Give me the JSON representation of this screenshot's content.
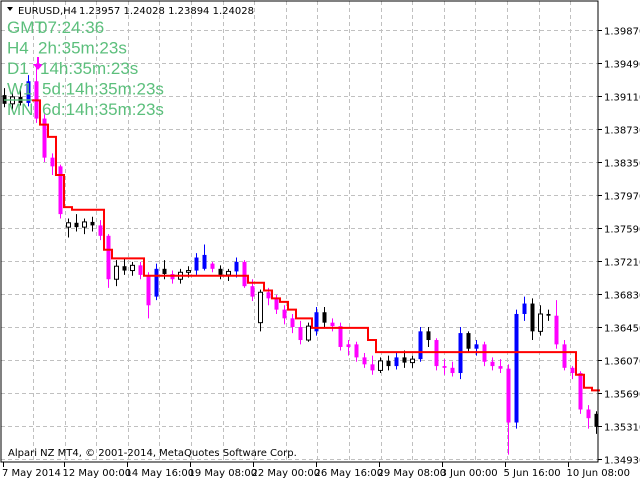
{
  "header": {
    "symbol": "EURUSD,H4",
    "ohlc": "1.23957 1.24028 1.23894 1.24028",
    "menu_icon": "triangle-down-icon"
  },
  "overlay": {
    "color": "#5cbf7c",
    "lines": [
      {
        "label": "GMT",
        "value": "07:24:36"
      },
      {
        "label": "H4",
        "value": "2h:35m:23s"
      },
      {
        "label": "D1",
        "value": "14h:35m:23s"
      },
      {
        "label": "W1",
        "value": "5d:14h:35m:23s"
      },
      {
        "label": "MN",
        "value": "6d:14h:35m:23s"
      }
    ]
  },
  "footer": {
    "copyright": "Alpari NZ MT4, © 2001-2014, MetaQuotes Software Corp."
  },
  "colors": {
    "bear_trend": "#ff00ff",
    "bull_trend": "#0000ff",
    "neutral": "#000000",
    "trend_line": "#ff0000",
    "grid": "#c0c0c0",
    "signal_arrow": "#ff00ff"
  },
  "chart_data": {
    "type": "candlestick",
    "timeframe": "H4",
    "ylim": [
      1.348,
      1.402
    ],
    "grid": true,
    "y_ticks": [
      "1.39870",
      "1.39490",
      "1.39110",
      "1.38730",
      "1.38350",
      "1.37970",
      "1.37590",
      "1.37210",
      "1.36830",
      "1.36450",
      "1.36070",
      "1.35690",
      "1.35310",
      "1.34930"
    ],
    "x_ticks": [
      "7 May 2014",
      "12 May 00:00",
      "14 May 16:00",
      "19 May 08:00",
      "22 May 00:00",
      "26 May 16:00",
      "29 May 08:00",
      "3 Jun 00:00",
      "5 Jun 16:00",
      "10 Jun 08:00"
    ],
    "candle_fields": [
      "open",
      "high",
      "low",
      "close",
      "color"
    ],
    "candles": [
      [
        1.3912,
        1.392,
        1.3898,
        1.3902,
        "k"
      ],
      [
        1.3902,
        1.3915,
        1.3895,
        1.391,
        "w"
      ],
      [
        1.391,
        1.3922,
        1.39,
        1.3903,
        "k"
      ],
      [
        1.3903,
        1.3935,
        1.3899,
        1.3928,
        "b"
      ],
      [
        1.3928,
        1.3945,
        1.388,
        1.3885,
        "m"
      ],
      [
        1.3885,
        1.389,
        1.3835,
        1.384,
        "m"
      ],
      [
        1.384,
        1.3845,
        1.382,
        1.383,
        "m"
      ],
      [
        1.383,
        1.3832,
        1.377,
        1.3775,
        "m"
      ],
      [
        1.376,
        1.377,
        1.3748,
        1.3765,
        "w"
      ],
      [
        1.3765,
        1.3775,
        1.3755,
        1.376,
        "k"
      ],
      [
        1.376,
        1.377,
        1.3752,
        1.3766,
        "w"
      ],
      [
        1.3766,
        1.3772,
        1.3755,
        1.3762,
        "k"
      ],
      [
        1.3762,
        1.3768,
        1.3745,
        1.375,
        "m"
      ],
      [
        1.375,
        1.3752,
        1.369,
        1.37,
        "m"
      ],
      [
        1.37,
        1.3722,
        1.3692,
        1.3715,
        "w"
      ],
      [
        1.3715,
        1.3725,
        1.3705,
        1.371,
        "k"
      ],
      [
        1.371,
        1.372,
        1.3704,
        1.3716,
        "w"
      ],
      [
        1.3716,
        1.372,
        1.37,
        1.3705,
        "m"
      ],
      [
        1.3705,
        1.3708,
        1.3655,
        1.367,
        "m"
      ],
      [
        1.368,
        1.3718,
        1.3676,
        1.3712,
        "b"
      ],
      [
        1.3712,
        1.3722,
        1.37,
        1.3706,
        "k"
      ],
      [
        1.3706,
        1.371,
        1.3695,
        1.37,
        "m"
      ],
      [
        1.37,
        1.3712,
        1.3695,
        1.3708,
        "w"
      ],
      [
        1.3708,
        1.3715,
        1.3702,
        1.371,
        "w"
      ],
      [
        1.371,
        1.373,
        1.3705,
        1.3725,
        "b"
      ],
      [
        1.3712,
        1.374,
        1.371,
        1.3728,
        "b"
      ],
      [
        1.3718,
        1.372,
        1.3708,
        1.3712,
        "m"
      ],
      [
        1.3712,
        1.3716,
        1.37,
        1.3705,
        "k"
      ],
      [
        1.3705,
        1.3712,
        1.3698,
        1.3709,
        "w"
      ],
      [
        1.3709,
        1.3725,
        1.3702,
        1.372,
        "b"
      ],
      [
        1.372,
        1.3722,
        1.369,
        1.3692,
        "m"
      ],
      [
        1.3692,
        1.37,
        1.3675,
        1.368,
        "m"
      ],
      [
        1.365,
        1.3688,
        1.364,
        1.3685,
        "w"
      ],
      [
        1.3685,
        1.369,
        1.367,
        1.3678,
        "m"
      ],
      [
        1.3678,
        1.3682,
        1.366,
        1.3665,
        "m"
      ],
      [
        1.3665,
        1.367,
        1.3648,
        1.3655,
        "m"
      ],
      [
        1.3655,
        1.366,
        1.3638,
        1.3645,
        "m"
      ],
      [
        1.3645,
        1.3652,
        1.3625,
        1.363,
        "m"
      ],
      [
        1.363,
        1.365,
        1.3628,
        1.3646,
        "w"
      ],
      [
        1.364,
        1.3668,
        1.3635,
        1.3662,
        "b"
      ],
      [
        1.3662,
        1.3668,
        1.3645,
        1.365,
        "k"
      ],
      [
        1.365,
        1.3655,
        1.364,
        1.3646,
        "m"
      ],
      [
        1.3646,
        1.365,
        1.3618,
        1.3622,
        "m"
      ],
      [
        1.3622,
        1.363,
        1.3612,
        1.3625,
        "m"
      ],
      [
        1.3625,
        1.3628,
        1.3605,
        1.361,
        "m"
      ],
      [
        1.361,
        1.3615,
        1.3598,
        1.3602,
        "m"
      ],
      [
        1.3602,
        1.3612,
        1.359,
        1.3595,
        "m"
      ],
      [
        1.3595,
        1.361,
        1.3592,
        1.3606,
        "w"
      ],
      [
        1.3606,
        1.3612,
        1.3595,
        1.36,
        "k"
      ],
      [
        1.36,
        1.3615,
        1.3596,
        1.361,
        "b"
      ],
      [
        1.361,
        1.3618,
        1.3598,
        1.3604,
        "k"
      ],
      [
        1.3604,
        1.3612,
        1.3598,
        1.3608,
        "w"
      ],
      [
        1.3608,
        1.3645,
        1.3605,
        1.364,
        "b"
      ],
      [
        1.364,
        1.3645,
        1.3622,
        1.363,
        "k"
      ],
      [
        1.363,
        1.3632,
        1.3595,
        1.36,
        "m"
      ],
      [
        1.36,
        1.3608,
        1.359,
        1.3598,
        "m"
      ],
      [
        1.3598,
        1.3605,
        1.3588,
        1.3592,
        "m"
      ],
      [
        1.3592,
        1.3645,
        1.3585,
        1.3638,
        "b"
      ],
      [
        1.3638,
        1.364,
        1.3615,
        1.362,
        "k"
      ],
      [
        1.362,
        1.363,
        1.3612,
        1.3625,
        "b"
      ],
      [
        1.3625,
        1.3628,
        1.36,
        1.3605,
        "m"
      ],
      [
        1.3605,
        1.361,
        1.3595,
        1.36,
        "m"
      ],
      [
        1.36,
        1.3608,
        1.3592,
        1.3597,
        "m"
      ],
      [
        1.3597,
        1.3602,
        1.3498,
        1.3535,
        "m"
      ],
      [
        1.3535,
        1.3665,
        1.3528,
        1.366,
        "b"
      ],
      [
        1.366,
        1.368,
        1.3652,
        1.3672,
        "b"
      ],
      [
        1.3672,
        1.3678,
        1.363,
        1.364,
        "k"
      ],
      [
        1.364,
        1.367,
        1.3635,
        1.366,
        "w"
      ],
      [
        1.366,
        1.3665,
        1.3652,
        1.3658,
        "k"
      ],
      [
        1.3658,
        1.3676,
        1.362,
        1.3625,
        "m"
      ],
      [
        1.3625,
        1.363,
        1.3595,
        1.3598,
        "m"
      ],
      [
        1.3598,
        1.36,
        1.3585,
        1.3592,
        "m"
      ],
      [
        1.3592,
        1.3594,
        1.3545,
        1.355,
        "m"
      ],
      [
        1.355,
        1.3555,
        1.3528,
        1.354,
        "m"
      ],
      [
        1.3545,
        1.3548,
        1.3522,
        1.353,
        "k"
      ]
    ],
    "trend_line": [
      null,
      null,
      null,
      null,
      1.3906,
      1.3878,
      1.3864,
      1.382,
      1.3783,
      1.378,
      1.378,
      1.378,
      1.378,
      1.3734,
      1.3724,
      1.3724,
      1.3724,
      1.3724,
      1.3704,
      1.3704,
      1.3704,
      1.3704,
      1.3704,
      1.3704,
      1.3704,
      1.3704,
      1.3704,
      1.3704,
      1.3704,
      1.3704,
      1.3704,
      1.3696,
      1.3696,
      1.3687,
      1.3678,
      1.3674,
      1.3665,
      1.3655,
      1.3655,
      1.3644,
      1.3644,
      1.3644,
      1.3644,
      1.3644,
      1.3644,
      1.3644,
      1.363,
      1.3616,
      1.3616,
      1.3616,
      1.3616,
      1.3616,
      1.3616,
      1.3616,
      1.3616,
      1.3616,
      1.3616,
      1.3616,
      1.3616,
      1.3616,
      1.3616,
      1.3616,
      1.3616,
      1.3616,
      1.3616,
      1.3616,
      1.3616,
      1.3616,
      1.3616,
      1.3616,
      1.3616,
      1.3616,
      1.359,
      1.3575,
      1.3572
    ],
    "signals": [
      {
        "bar": 4,
        "type": "sell-arrow"
      }
    ]
  }
}
